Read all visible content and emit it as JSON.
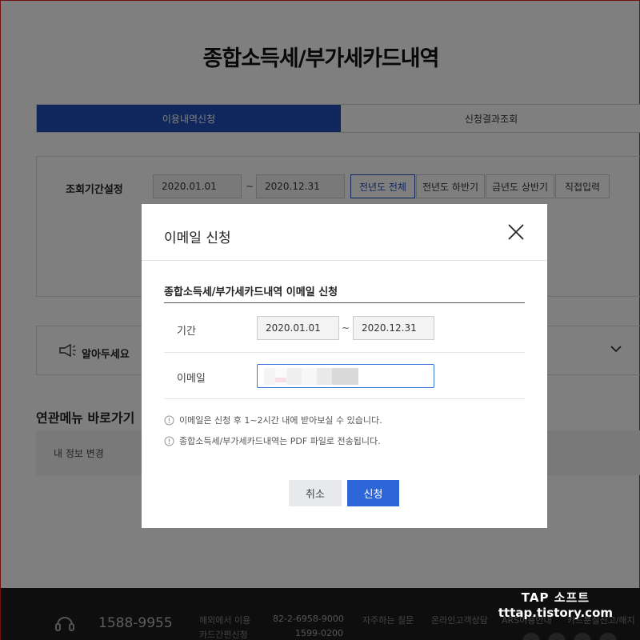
{
  "page": {
    "title": "종합소득세/부가세카드내역",
    "tabs": [
      {
        "label": "이용내역신청",
        "active": true
      },
      {
        "label": "신청결과조회",
        "active": false
      }
    ],
    "search": {
      "label": "조회기간설정",
      "start_date": "2020.01.01",
      "end_date": "2020.12.31",
      "tilde": "~",
      "period_buttons": [
        "전년도 전체",
        "전년도 하반기",
        "금년도 상반기",
        "직접입력"
      ],
      "selected_period": "전년도 전체"
    },
    "notice": {
      "label": "알아두세요",
      "icon": "megaphone-icon"
    },
    "related": {
      "title": "연관메뉴 바로가기",
      "items": [
        "내 정보 변경"
      ]
    }
  },
  "footer": {
    "phone": "1588-9955",
    "overseas_label": "해외에서 이용",
    "overseas_number": "82-2-6958-9000",
    "card_label": "카드간편신청",
    "card_number": "1599-0200",
    "links": [
      "자주하는 질문",
      "온라인고객상담",
      "ARS이용안내",
      "카드분실신고/해지"
    ]
  },
  "watermark": {
    "line1": "TAP 소프트",
    "line2": "tttap.tistory.com"
  },
  "modal": {
    "title": "이메일 신청",
    "section_title": "종합소득세/부가세카드내역 이메일 신청",
    "period_label": "기간",
    "start_date": "2020.01.01",
    "end_date": "2020.12.31",
    "tilde": "~",
    "email_label": "이메일",
    "info": [
      "이메일은 신청 후 1~2시간 내에 받아보실 수 있습니다.",
      "종합소득세/부가세카드내역는 PDF 파일로 전송됩니다."
    ],
    "cancel_label": "취소",
    "apply_label": "신청"
  },
  "colors": {
    "accent": "#1e4fb8",
    "button_primary": "#2d66d8",
    "footer_bg": "#1d1d1d"
  }
}
